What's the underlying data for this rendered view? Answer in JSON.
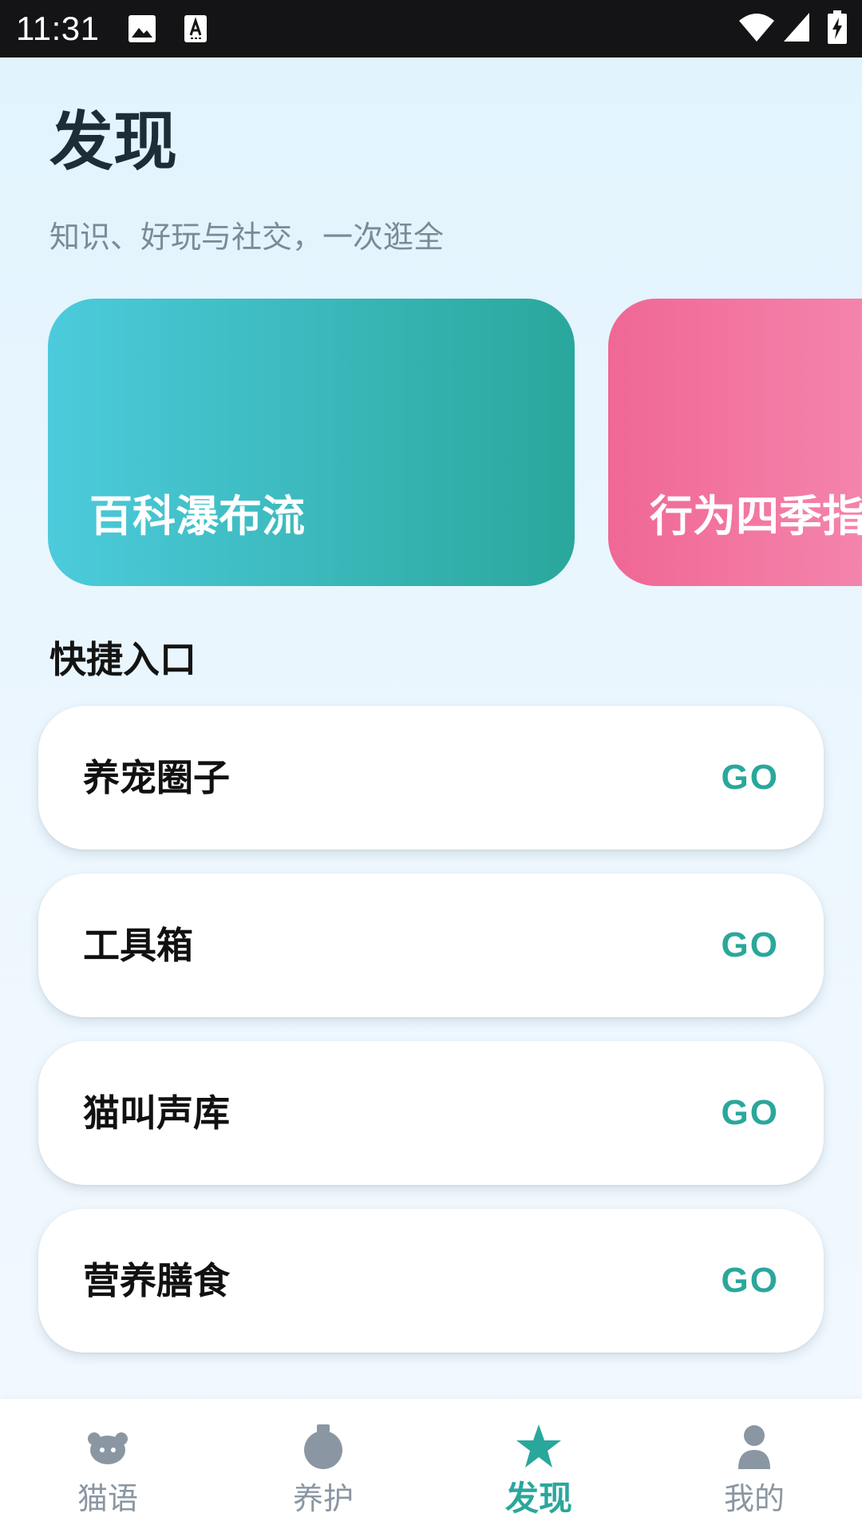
{
  "status_bar": {
    "time": "11:31"
  },
  "header": {
    "title": "发现",
    "subtitle": "知识、好玩与社交，一次逛全"
  },
  "carousel": {
    "cards": [
      {
        "label": "百科瀑布流",
        "color_start": "#4ccbdc",
        "color_end": "#2aa79c"
      },
      {
        "label": "行为四季指",
        "color_start": "#f06794",
        "color_end": "#f58db3"
      }
    ]
  },
  "quick_entry": {
    "title": "快捷入口",
    "items": [
      {
        "label": "养宠圈子",
        "action": "GO"
      },
      {
        "label": "工具箱",
        "action": "GO"
      },
      {
        "label": "猫叫声库",
        "action": "GO"
      },
      {
        "label": "营养膳食",
        "action": "GO"
      }
    ]
  },
  "bottom_nav": {
    "items": [
      {
        "label": "猫语",
        "icon": "cat-face-icon",
        "active": false
      },
      {
        "label": "养护",
        "icon": "care-icon",
        "active": false
      },
      {
        "label": "发现",
        "icon": "star-icon",
        "active": true
      },
      {
        "label": "我的",
        "icon": "person-icon",
        "active": false
      }
    ]
  },
  "colors": {
    "accent": "#2aa79c",
    "inactive": "#8a97a2",
    "title": "#1d2d38"
  }
}
